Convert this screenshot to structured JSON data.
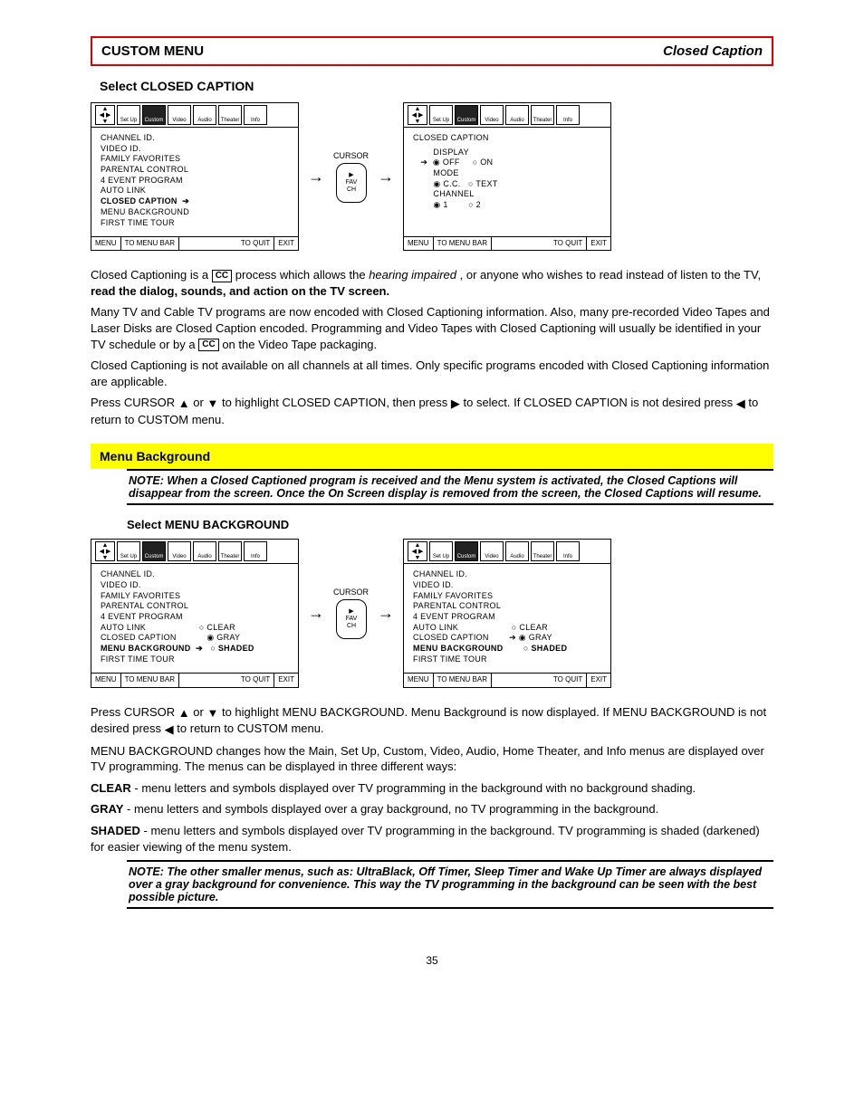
{
  "header": {
    "left": "CUSTOM MENU",
    "right": "Closed Caption"
  },
  "cc_subtitle": "Select CLOSED CAPTION",
  "menu_tabs": [
    "Set Up",
    "Custom",
    "Video",
    "Audio",
    "Theater",
    "Info"
  ],
  "cc_left_menu": {
    "lines": [
      "CHANNEL ID.",
      "VIDEO ID.",
      "FAMILY FAVORITES",
      "PARENTAL CONTROL",
      "4 EVENT PROGRAM",
      "AUTO LINK",
      "CLOSED CAPTION  ➔",
      "MENU BACKGROUND",
      "FIRST TIME TOUR"
    ],
    "bold_index": 6
  },
  "cc_right_menu": {
    "title": "CLOSED CAPTION",
    "lines": [
      "        DISPLAY",
      "   ➔  ◉ OFF     ○ ON",
      "        MODE",
      "        ◉ C.C.   ○ TEXT",
      "        CHANNEL",
      "        ◉ 1        ○ 2"
    ]
  },
  "cursor_label": "CURSOR",
  "diamond": {
    "top": "▶",
    "mid": "FAV",
    "bot": "CH"
  },
  "footer": {
    "a": "MENU",
    "b": "TO MENU BAR",
    "c": "TO QUIT",
    "d": "EXIT"
  },
  "cc_para1_a": "Closed Captioning is a ",
  "cc_para1_b": " process which allows the ",
  "cc_para1_c": "hearing impaired",
  "cc_para1_d": ", or anyone who wishes to read instead of listen to the TV, ",
  "cc_para1_e": "read the dialog, sounds, and action on the TV screen.",
  "cc_para2_a": "Many TV and Cable TV programs are now encoded with Closed Captioning information. Also, many pre-recorded Video Tapes and Laser Disks are Closed Caption encoded. Programming and Video Tapes with Closed Captioning will usually be identified in your TV schedule or by a ",
  "cc_para2_b": " on the Video Tape packaging.",
  "cc_para3_a": "Closed Captioning is not available on all channels at all times. Only specific programs encoded with Closed Captioning information are applicable.",
  "cc_para4_a": "Press CURSOR ",
  "cc_para4_b": " or ",
  "cc_para4_c": " to highlight CLOSED CAPTION, then press ",
  "cc_para4_d": " to select. If CLOSED CAPTION is not desired press ",
  "cc_para4_e": " to return to CUSTOM menu.",
  "mb_band": "Menu Background",
  "mb_note": "NOTE: When a Closed Captioned program is received and the Menu system is activated, the Closed Captions will disappear from the screen. Once the On Screen display is removed from the screen, the Closed Captions will resume.",
  "mb_sub": "Select MENU BACKGROUND",
  "mb_left_menu": {
    "lines": [
      "CHANNEL ID.",
      "VIDEO ID.",
      "FAMILY FAVORITES",
      "PARENTAL CONTROL",
      "4 EVENT PROGRAM",
      "AUTO LINK                     ○ CLEAR",
      "CLOSED CAPTION            ◉ GRAY",
      "MENU BACKGROUND  ➔   ○ SHADED",
      "FIRST TIME TOUR"
    ],
    "bold_index": 7
  },
  "mb_right_menu": {
    "lines": [
      "CHANNEL ID.",
      "VIDEO ID.",
      "FAMILY FAVORITES",
      "PARENTAL CONTROL",
      "4 EVENT PROGRAM",
      "AUTO LINK                     ○ CLEAR",
      "CLOSED CAPTION        ➔ ◉ GRAY",
      "MENU BACKGROUND        ○ SHADED",
      "FIRST TIME TOUR"
    ],
    "bold_index": 7
  },
  "mb_para1_a": "Press CURSOR ",
  "mb_para1_b": " or ",
  "mb_para1_c": " to highlight MENU BACKGROUND. Menu Background is now displayed. If MENU BACKGROUND is not desired press ",
  "mb_para1_d": " to return to CUSTOM menu.",
  "mb_desc": {
    "intro": "MENU BACKGROUND changes how the Main, Set Up, Custom, Video, Audio, Home Theater, and Info menus are displayed over TV programming. The menus can be displayed in three different ways:",
    "label1": "CLEAR",
    "text1": "menu letters and symbols displayed over TV programming in the background with no background shading.",
    "label2": "GRAY",
    "text2": "menu letters and symbols displayed over a gray background, no TV programming in the background.",
    "label3": "SHADED",
    "text3": "menu letters and symbols displayed over TV programming in the background. TV programming is shaded (darkened) for easier viewing of the menu system."
  },
  "mb_note2": "NOTE: The other smaller menus, such as: UltraBlack, Off Timer, Sleep Timer and Wake Up Timer are always displayed over a gray background for convenience. This way the TV programming in the background can be seen with the best possible picture.",
  "page": "35"
}
